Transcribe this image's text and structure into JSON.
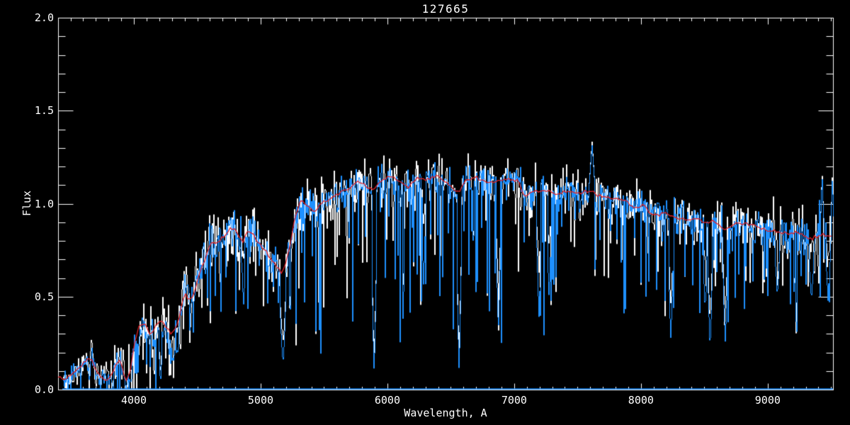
{
  "chart": {
    "title": "127665",
    "xlabel": "Wavelength, A",
    "ylabel": "Flux"
  },
  "chart_data": {
    "type": "line",
    "title": "127665",
    "xlabel": "Wavelength, A",
    "ylabel": "Flux",
    "xlim": [
      3402,
      9515
    ],
    "ylim": [
      0.0,
      2.0
    ],
    "x_ticks_major": [
      4000,
      5000,
      6000,
      7000,
      8000,
      9000
    ],
    "x_tick_labels": [
      "4000",
      "5000",
      "6000",
      "7000",
      "8000",
      "9000"
    ],
    "x_minor_step": 100,
    "y_ticks_major": [
      0.0,
      0.5,
      1.0,
      1.5,
      2.0
    ],
    "y_tick_labels": [
      "0.0",
      "0.5",
      "1.0",
      "1.5",
      "2.0"
    ],
    "y_minor_step": 0.1,
    "grid": false,
    "legend": false,
    "background_color": "#000000",
    "axis_color": "#ffffff",
    "series": [
      {
        "name": "raw-spectrum",
        "color": "#ffffff",
        "style": "noisy-line"
      },
      {
        "name": "observed-spectrum",
        "color": "#1e90ff",
        "style": "noisy-line"
      },
      {
        "name": "zero-level-line",
        "color": "#1e90ff",
        "style": "flat",
        "value": 0.004
      },
      {
        "name": "smoothed-model",
        "color": "#e02228",
        "style": "smooth-line"
      }
    ],
    "noise_seed": 127665,
    "continuum_points": [
      [
        3402,
        0.07
      ],
      [
        3435,
        0.06
      ],
      [
        3470,
        0.055
      ],
      [
        3510,
        0.08
      ],
      [
        3550,
        0.11
      ],
      [
        3590,
        0.13
      ],
      [
        3630,
        0.16
      ],
      [
        3665,
        0.17
      ],
      [
        3700,
        0.1
      ],
      [
        3740,
        0.065
      ],
      [
        3780,
        0.05
      ],
      [
        3820,
        0.08
      ],
      [
        3860,
        0.14
      ],
      [
        3895,
        0.16
      ],
      [
        3925,
        0.07
      ],
      [
        3945,
        0.05
      ],
      [
        3975,
        0.12
      ],
      [
        4005,
        0.25
      ],
      [
        4040,
        0.34
      ],
      [
        4080,
        0.36
      ],
      [
        4120,
        0.3
      ],
      [
        4160,
        0.32
      ],
      [
        4200,
        0.37
      ],
      [
        4240,
        0.35
      ],
      [
        4280,
        0.31
      ],
      [
        4320,
        0.31
      ],
      [
        4360,
        0.4
      ],
      [
        4400,
        0.52
      ],
      [
        4435,
        0.48
      ],
      [
        4470,
        0.51
      ],
      [
        4520,
        0.63
      ],
      [
        4560,
        0.7
      ],
      [
        4600,
        0.78
      ],
      [
        4650,
        0.79
      ],
      [
        4700,
        0.82
      ],
      [
        4750,
        0.86
      ],
      [
        4800,
        0.86
      ],
      [
        4830,
        0.82
      ],
      [
        4860,
        0.8
      ],
      [
        4900,
        0.85
      ],
      [
        4950,
        0.83
      ],
      [
        5000,
        0.77
      ],
      [
        5050,
        0.74
      ],
      [
        5100,
        0.69
      ],
      [
        5140,
        0.65
      ],
      [
        5170,
        0.62
      ],
      [
        5220,
        0.73
      ],
      [
        5270,
        0.92
      ],
      [
        5320,
        1.03
      ],
      [
        5380,
        0.98
      ],
      [
        5430,
        0.96
      ],
      [
        5480,
        1.01
      ],
      [
        5530,
        1.02
      ],
      [
        5600,
        1.05
      ],
      [
        5650,
        1.07
      ],
      [
        5700,
        1.08
      ],
      [
        5760,
        1.12
      ],
      [
        5820,
        1.1
      ],
      [
        5890,
        1.08
      ],
      [
        5950,
        1.13
      ],
      [
        6020,
        1.15
      ],
      [
        6100,
        1.12
      ],
      [
        6160,
        1.09
      ],
      [
        6230,
        1.14
      ],
      [
        6300,
        1.13
      ],
      [
        6380,
        1.15
      ],
      [
        6450,
        1.12
      ],
      [
        6520,
        1.08
      ],
      [
        6560,
        1.06
      ],
      [
        6620,
        1.13
      ],
      [
        6700,
        1.14
      ],
      [
        6790,
        1.11
      ],
      [
        6860,
        1.12
      ],
      [
        6950,
        1.13
      ],
      [
        7030,
        1.12
      ],
      [
        7085,
        1.04
      ],
      [
        7165,
        1.07
      ],
      [
        7245,
        1.07
      ],
      [
        7330,
        1.05
      ],
      [
        7415,
        1.07
      ],
      [
        7500,
        1.06
      ],
      [
        7610,
        1.07
      ],
      [
        7665,
        1.04
      ],
      [
        7750,
        1.03
      ],
      [
        7860,
        1.02
      ],
      [
        7915,
        0.99
      ],
      [
        7970,
        0.98
      ],
      [
        8030,
        0.99
      ],
      [
        8085,
        0.95
      ],
      [
        8140,
        0.94
      ],
      [
        8195,
        0.95
      ],
      [
        8250,
        0.93
      ],
      [
        8345,
        0.91
      ],
      [
        8440,
        0.92
      ],
      [
        8495,
        0.9
      ],
      [
        8550,
        0.91
      ],
      [
        8590,
        0.9
      ],
      [
        8660,
        0.86
      ],
      [
        8757,
        0.89
      ],
      [
        8870,
        0.89
      ],
      [
        8950,
        0.87
      ],
      [
        9040,
        0.85
      ],
      [
        9150,
        0.84
      ],
      [
        9260,
        0.84
      ],
      [
        9320,
        0.81
      ],
      [
        9375,
        0.82
      ],
      [
        9440,
        0.83
      ],
      [
        9515,
        0.82
      ]
    ],
    "noise_band": [
      [
        3402,
        0.03,
        0.045
      ],
      [
        3700,
        0.038,
        0.055
      ],
      [
        4000,
        0.055,
        0.085
      ],
      [
        4300,
        0.07,
        0.1
      ],
      [
        4600,
        0.072,
        0.105
      ],
      [
        5000,
        0.06,
        0.092
      ],
      [
        5400,
        0.055,
        0.085
      ],
      [
        5800,
        0.05,
        0.08
      ],
      [
        6200,
        0.046,
        0.075
      ],
      [
        6600,
        0.05,
        0.08
      ],
      [
        7000,
        0.045,
        0.072
      ],
      [
        7400,
        0.044,
        0.07
      ],
      [
        7800,
        0.05,
        0.075
      ],
      [
        8200,
        0.052,
        0.08
      ],
      [
        8600,
        0.055,
        0.085
      ],
      [
        9000,
        0.05,
        0.08
      ],
      [
        9300,
        0.07,
        0.1
      ],
      [
        9515,
        0.125,
        0.15
      ]
    ],
    "dip_strength": [
      [
        3402,
        0.08
      ],
      [
        4000,
        0.28
      ],
      [
        4400,
        0.4
      ],
      [
        5000,
        0.55
      ],
      [
        5600,
        0.8
      ],
      [
        6200,
        0.85
      ],
      [
        6900,
        0.8
      ],
      [
        7600,
        0.6
      ],
      [
        8200,
        0.55
      ],
      [
        8800,
        0.5
      ],
      [
        9515,
        0.55
      ]
    ],
    "absorption_features": [
      [
        3935,
        0.01,
        2
      ],
      [
        3970,
        0.02,
        2
      ],
      [
        4205,
        0.02,
        2
      ],
      [
        4305,
        0.13,
        3
      ],
      [
        4340,
        0.18,
        2
      ],
      [
        4860,
        0.45,
        2
      ],
      [
        5170,
        0.12,
        4
      ],
      [
        5890,
        0.04,
        3
      ],
      [
        6280,
        0.55,
        2
      ],
      [
        6560,
        0.08,
        3
      ],
      [
        6870,
        0.3,
        3
      ],
      [
        7190,
        0.38,
        3
      ],
      [
        7270,
        0.45,
        2
      ],
      [
        7620,
        0.55,
        3
      ],
      [
        8230,
        0.27,
        3
      ],
      [
        8500,
        0.4,
        2
      ],
      [
        8540,
        0.2,
        3
      ],
      [
        8660,
        0.24,
        3
      ],
      [
        9070,
        0.5,
        3
      ],
      [
        9340,
        0.46,
        3
      ],
      [
        9470,
        0.46,
        2
      ]
    ],
    "emission_features": [
      [
        7609,
        1.32,
        4
      ],
      [
        9424,
        1.17,
        2
      ],
      [
        9505,
        1.15,
        2
      ]
    ]
  }
}
